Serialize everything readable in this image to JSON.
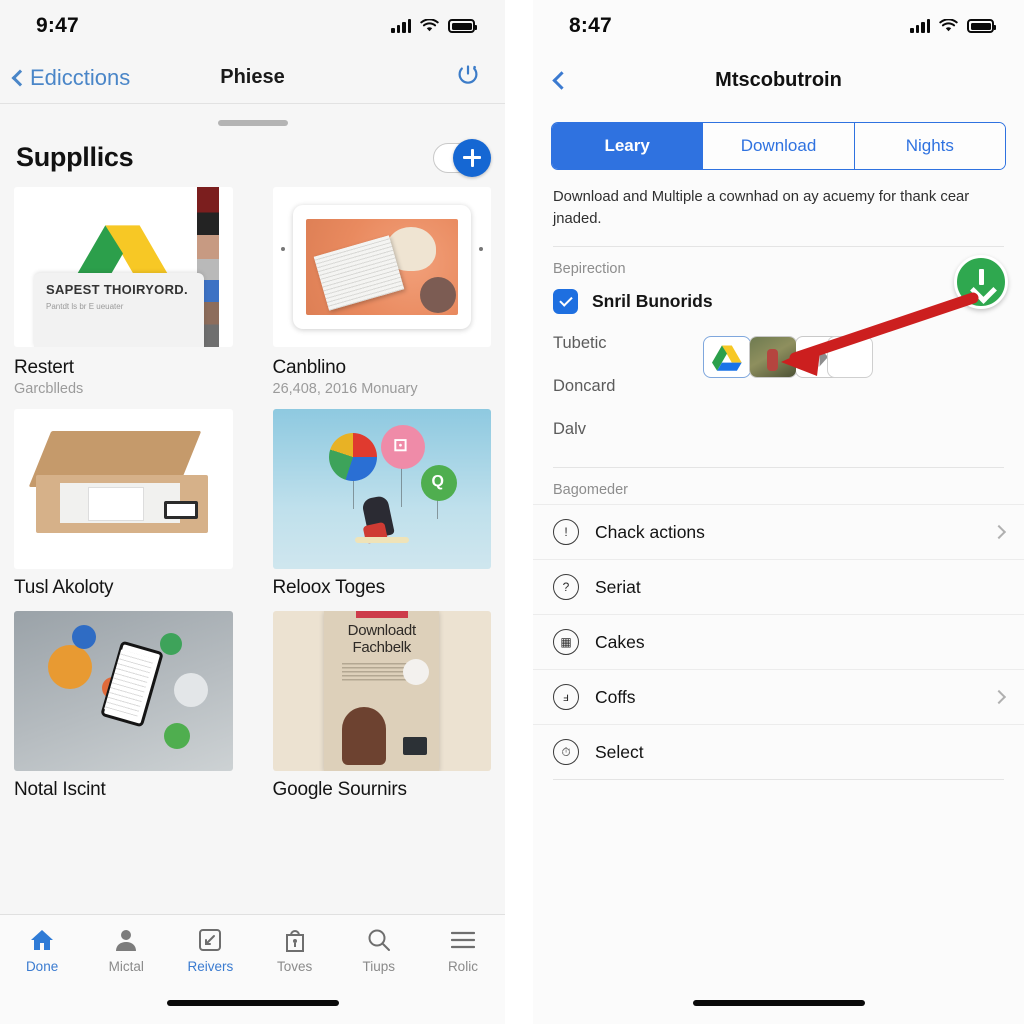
{
  "left": {
    "status": {
      "time": "9:47",
      "signal_icon": "cellular-bars-icon",
      "wifi_icon": "wifi-icon",
      "battery_icon": "battery-icon"
    },
    "nav": {
      "back_label": "Edicctions",
      "title": "Phiese",
      "right_icon": "power-refresh-icon"
    },
    "section": {
      "title": "Suppllics",
      "toggle_name": "visibility-toggle",
      "add_label": "+"
    },
    "cards": [
      {
        "title": "Restert",
        "subtitle": "Garcblleds",
        "art": "drive-logo-thumbnail",
        "overlay_title": "SAPEST THOIRYORD.",
        "overlay_sub": "Pantdt ls br E ueuater"
      },
      {
        "title": "Canblino",
        "subtitle": "26,408, 2016 Monuary",
        "art": "tablet-photo-thumbnail"
      },
      {
        "title": "Tusl Akoloty",
        "subtitle": "",
        "art": "cardboard-box-thumbnail"
      },
      {
        "title": "Reloox Toges",
        "subtitle": "",
        "art": "balloons-photo-thumbnail"
      },
      {
        "title": "Notal Iscint",
        "subtitle": "",
        "art": "gadgets-photo-thumbnail"
      },
      {
        "title": "Google Sournirs",
        "subtitle": "",
        "art": "poster-photo-thumbnail",
        "poster_title": "Downloadt Fachbelk"
      }
    ],
    "tabs": [
      {
        "label": "Done",
        "icon": "home-icon",
        "active": true
      },
      {
        "label": "Mictal",
        "icon": "person-icon",
        "active": false
      },
      {
        "label": "Reivers",
        "icon": "image-resize-icon",
        "active": true
      },
      {
        "label": "Toves",
        "icon": "shopping-bag-icon",
        "active": false
      },
      {
        "label": "Tiups",
        "icon": "search-icon",
        "active": false
      },
      {
        "label": "Rolic",
        "icon": "hamburger-menu-icon",
        "active": false
      }
    ]
  },
  "right": {
    "status": {
      "time": "8:47",
      "signal_icon": "cellular-bars-icon",
      "wifi_icon": "wifi-icon",
      "battery_icon": "battery-icon"
    },
    "nav": {
      "back_icon": "chevron-left-icon",
      "title": "Mtscobutroin"
    },
    "segments": [
      {
        "label": "Leary",
        "active": true
      },
      {
        "label": "Download",
        "active": false
      },
      {
        "label": "Nights",
        "active": false
      }
    ],
    "description": "Download and Multiple a cownhad on ay acuemy for thank cear jnaded.",
    "section_label": "Bepirection",
    "checkbox": {
      "label": "Snril Bunorids",
      "checked": true
    },
    "stack_rows": [
      "Tubetic",
      "Doncard",
      "Dalv"
    ],
    "thumbstrip": [
      {
        "name": "drive-logo-thumb",
        "selected": true
      },
      {
        "name": "photo-thumb",
        "selected": false
      },
      {
        "name": "shape-thumb",
        "selected": false
      }
    ],
    "download_fab": {
      "icon": "download-arrow-icon",
      "color": "#2fa84f"
    },
    "annotation": {
      "type": "arrow",
      "color": "#cc1f1f",
      "points_to": "thumbstrip"
    },
    "list": {
      "label": "Bagomeder",
      "rows": [
        {
          "label": "Chack actions",
          "icon": "info-circle-icon",
          "chevron": true
        },
        {
          "label": "Seriat",
          "icon": "question-circle-icon",
          "chevron": false
        },
        {
          "label": "Cakes",
          "icon": "card-circle-icon",
          "chevron": false
        },
        {
          "label": "Coffs",
          "icon": "note-circle-icon",
          "chevron": true
        },
        {
          "label": "Select",
          "icon": "clock-circle-icon",
          "chevron": false
        }
      ]
    }
  },
  "colors": {
    "accent_blue": "#2f72e0",
    "link_blue": "#4a86c8",
    "green": "#2fa84f",
    "red_arrow": "#cc1f1f"
  }
}
